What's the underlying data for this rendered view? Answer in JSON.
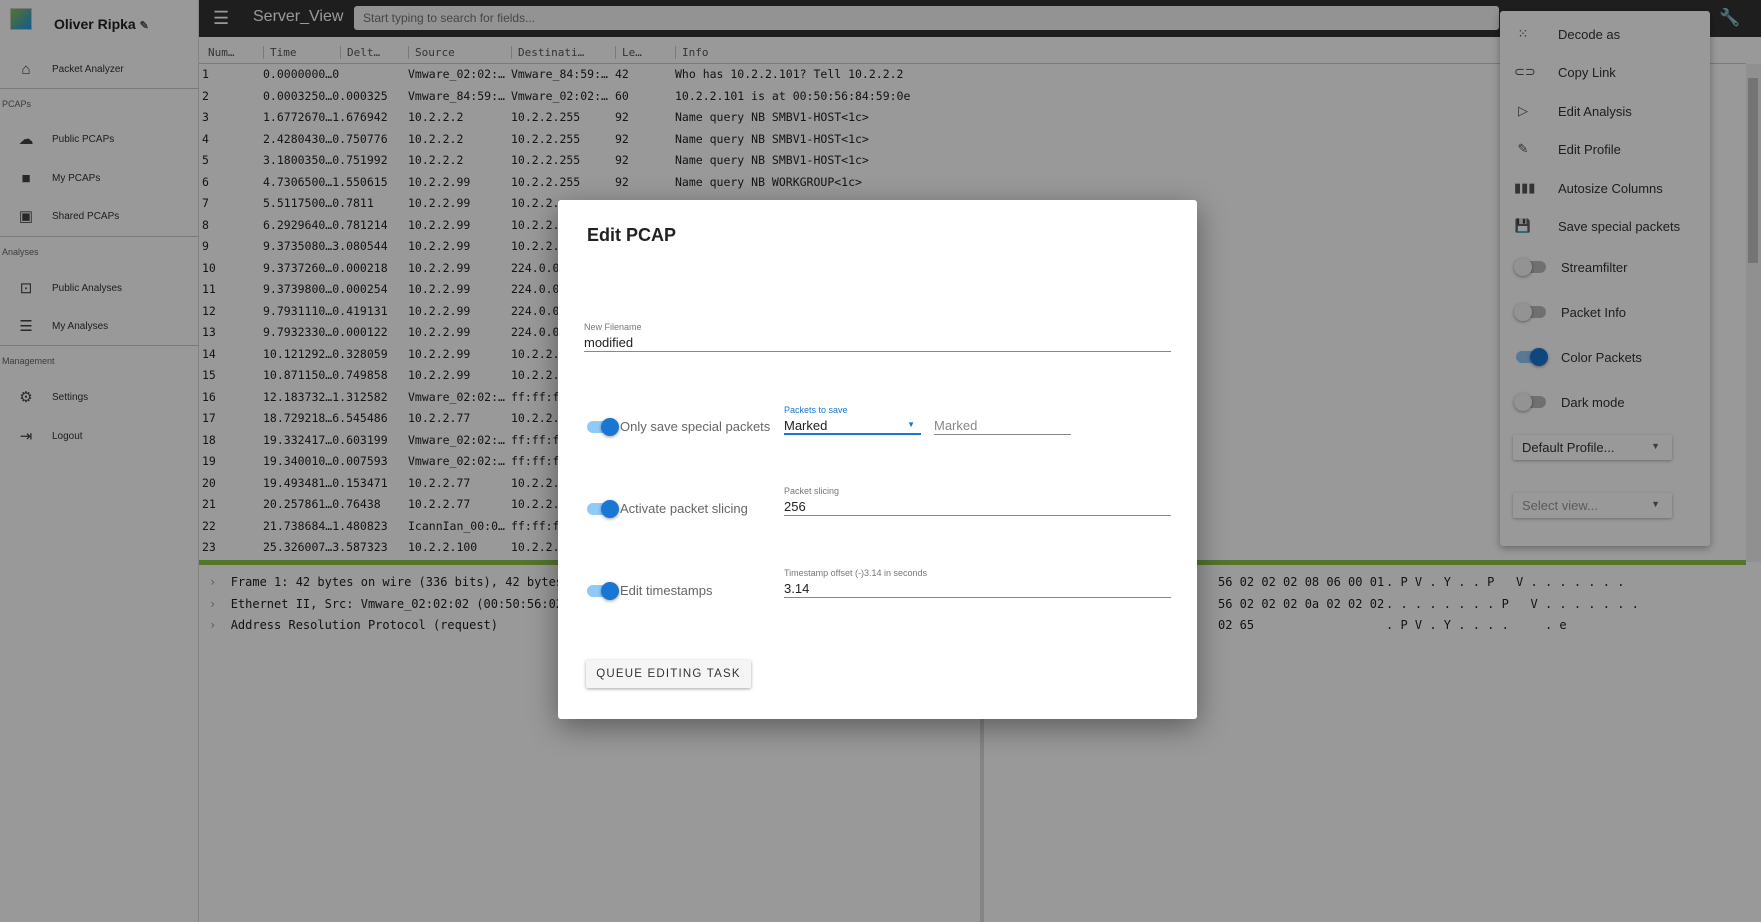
{
  "sidebar": {
    "user_name": "Oliver Ripka",
    "items": [
      {
        "label": "Packet Analyzer",
        "icon": "home-icon"
      },
      {
        "section": "PCAPs"
      },
      {
        "label": "Public PCAPs",
        "icon": "cloud-icon"
      },
      {
        "label": "My PCAPs",
        "icon": "folder-icon"
      },
      {
        "label": "Shared PCAPs",
        "icon": "shared-folder-icon"
      },
      {
        "section": "Analyses"
      },
      {
        "label": "Public Analyses",
        "icon": "upload-box-icon"
      },
      {
        "label": "My Analyses",
        "icon": "list-monitor-icon"
      },
      {
        "section": "Management"
      },
      {
        "label": "Settings",
        "icon": "gear-icon"
      },
      {
        "label": "Logout",
        "icon": "logout-icon"
      }
    ]
  },
  "header": {
    "title": "Server_View",
    "search_placeholder": "Start typing to search for fields..."
  },
  "table": {
    "columns": [
      "Num…",
      "Time",
      "Delt…",
      "Source",
      "Destinati…",
      "Le…",
      "Info"
    ],
    "rows": [
      [
        "1",
        "0.0000000…0",
        "Vmware_02:02:…",
        "Vmware_84:59:…",
        "42",
        "Who has 10.2.2.101? Tell 10.2.2.2"
      ],
      [
        "2",
        "0.0003250…0.000325",
        "Vmware_84:59:…",
        "Vmware_02:02:…",
        "60",
        "10.2.2.101 is at 00:50:56:84:59:0e"
      ],
      [
        "3",
        "1.6772670…1.676942",
        "10.2.2.2",
        "10.2.2.255",
        "92",
        "Name query NB SMBV1-HOST<1c>"
      ],
      [
        "4",
        "2.4280430…0.750776",
        "10.2.2.2",
        "10.2.2.255",
        "92",
        "Name query NB SMBV1-HOST<1c>"
      ],
      [
        "5",
        "3.1800350…0.751992",
        "10.2.2.2",
        "10.2.2.255",
        "92",
        "Name query NB SMBV1-HOST<1c>"
      ],
      [
        "6",
        "4.7306500…1.550615",
        "10.2.2.99",
        "10.2.2.255",
        "92",
        "Name query NB WORKGROUP<1c>"
      ],
      [
        "7",
        "5.5117500…0.7811",
        "10.2.2.99",
        "10.2.2.",
        "",
        ""
      ],
      [
        "8",
        "6.2929640…0.781214",
        "10.2.2.99",
        "10.2.2.",
        "",
        ""
      ],
      [
        "9",
        "9.3735080…3.080544",
        "10.2.2.99",
        "10.2.2.",
        "",
        ""
      ],
      [
        "10",
        "9.3737260…0.000218",
        "10.2.2.99",
        "224.0.0",
        "",
        ""
      ],
      [
        "11",
        "9.3739800…0.000254",
        "10.2.2.99",
        "224.0.0",
        "",
        ""
      ],
      [
        "12",
        "9.7931110…0.419131",
        "10.2.2.99",
        "224.0.0",
        "",
        ""
      ],
      [
        "13",
        "9.7932330…0.000122",
        "10.2.2.99",
        "224.0.0",
        "",
        ""
      ],
      [
        "14",
        "10.121292…0.328059",
        "10.2.2.99",
        "10.2.2.",
        "",
        ""
      ],
      [
        "15",
        "10.871150…0.749858",
        "10.2.2.99",
        "10.2.2.",
        "",
        ""
      ],
      [
        "16",
        "12.183732…1.312582",
        "Vmware_02:02:…",
        "ff:ff:f",
        "",
        ""
      ],
      [
        "17",
        "18.729218…6.545486",
        "10.2.2.77",
        "10.2.2.",
        "",
        ""
      ],
      [
        "18",
        "19.332417…0.603199",
        "Vmware_02:02:…",
        "ff:ff:f",
        "",
        ""
      ],
      [
        "19",
        "19.340010…0.007593",
        "Vmware_02:02:…",
        "ff:ff:f",
        "",
        ""
      ],
      [
        "20",
        "19.493481…0.153471",
        "10.2.2.77",
        "10.2.2.",
        "",
        ""
      ],
      [
        "21",
        "20.257861…0.76438",
        "10.2.2.77",
        "10.2.2.",
        "",
        ""
      ],
      [
        "22",
        "21.738684…1.480823",
        "IcannIan_00:0…",
        "ff:ff:f",
        "",
        ""
      ],
      [
        "23",
        "25.326007…3.587323",
        "10.2.2.100",
        "10.2.2.",
        "",
        ""
      ]
    ]
  },
  "details": [
    "Frame 1: 42 bytes on wire (336 bits), 42 bytes",
    "Ethernet II, Src: Vmware_02:02:02 (00:50:56:02:",
    "Address Resolution Protocol (request)"
  ],
  "hex": [
    {
      "bytes": "56 02 02 02 08 06 00 01",
      "ascii": ". P V . Y . . P   V . . . . . . ."
    },
    {
      "bytes": "56 02 02 02 0a 02 02 02",
      "ascii": ". . . . . . . . P   V . . . . . . ."
    },
    {
      "bytes": "02 65",
      "ascii": ". P V . Y . . . .     . e"
    }
  ],
  "menu": {
    "items": [
      {
        "label": "Decode as",
        "icon": "dotted-grid-icon"
      },
      {
        "label": "Copy Link",
        "icon": "link-icon"
      },
      {
        "label": "Edit Analysis",
        "icon": "play-box-icon"
      },
      {
        "label": "Edit Profile",
        "icon": "pencil-icon"
      },
      {
        "label": "Autosize Columns",
        "icon": "columns-icon"
      },
      {
        "label": "Save special packets",
        "icon": "floppy-icon"
      }
    ],
    "toggles": [
      {
        "label": "Streamfilter",
        "on": false
      },
      {
        "label": "Packet Info",
        "on": false
      },
      {
        "label": "Color Packets",
        "on": true
      },
      {
        "label": "Dark mode",
        "on": false
      }
    ],
    "profile_select": "Default Profile...",
    "view_select_placeholder": "Select view..."
  },
  "dialog": {
    "title": "Edit PCAP",
    "filename_label": "New Filename",
    "filename_value": "modified",
    "special_toggle_label": "Only save special packets",
    "special_toggle_on": true,
    "packets_to_save_label": "Packets to save",
    "packets_to_save_value": "Marked",
    "marked_field_value": "Marked",
    "slicing_toggle_label": "Activate packet slicing",
    "slicing_toggle_on": true,
    "slicing_label": "Packet slicing",
    "slicing_value": "256",
    "timestamp_toggle_label": "Edit timestamps",
    "timestamp_toggle_on": true,
    "timestamp_label": "Timestamp offset (-)3.14 in seconds",
    "timestamp_value": "3.14",
    "queue_button": "QUEUE EDITING TASK"
  },
  "colors": {
    "accent": "#1976d2",
    "header": "#333333",
    "split_bar": "#8bc34a"
  }
}
